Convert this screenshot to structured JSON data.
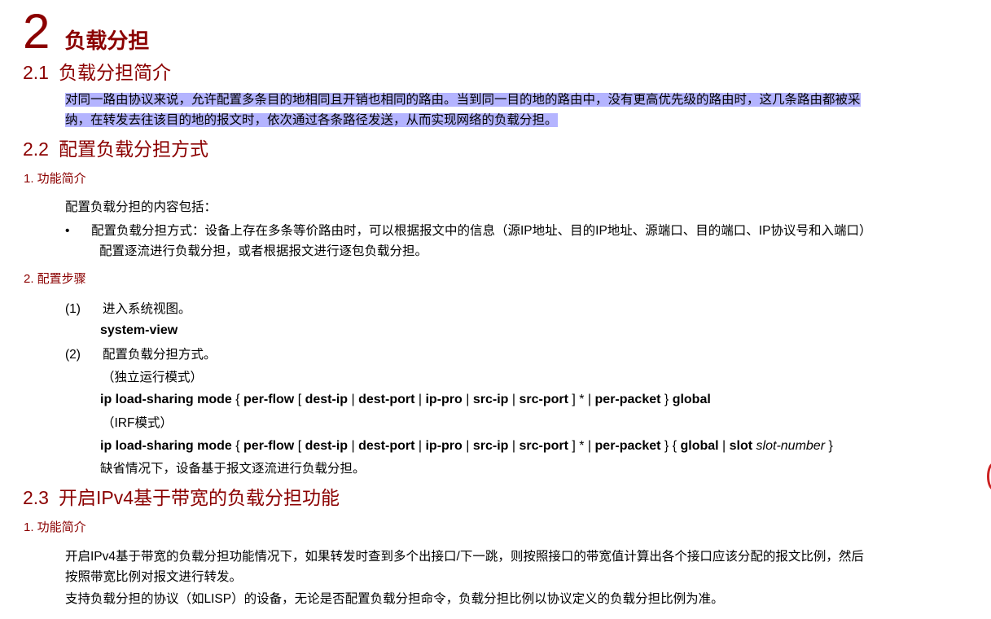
{
  "chapter": {
    "number": "2",
    "title": "负载分担"
  },
  "s21": {
    "number": "2.1",
    "title": "负载分担简介",
    "para_line1": "对同一路由协议来说，允许配置多条目的地相同且开销也相同的路由。当到同一目的地的路由中，没有更高优先级的路由时，这几条路由都被采",
    "para_line2": "纳，在转发去往该目的地的报文时，依次通过各条路径发送，从而实现网络的负载分担。"
  },
  "s22": {
    "number": "2.2",
    "title": "配置负载分担方式",
    "sub1_title": "1. 功能简介",
    "intro": "配置负载分担的内容包括：",
    "bullet_symbol": "•",
    "bullet_line1": "配置负载分担方式：设备上存在多条等价路由时，可以根据报文中的信息（源IP地址、目的IP地址、源端口、目的端口、IP协议号和入端口）",
    "bullet_line2": "配置逐流进行负载分担，或者根据报文进行逐包负载分担。",
    "sub2_title": "2. 配置步骤",
    "step1_num": "(1)",
    "step1_text": "进入系统视图。",
    "step1_cmd": "system-view",
    "step2_num": "(2)",
    "step2_text": "配置负载分担方式。",
    "mode1": "（独立运行模式）",
    "cmd1": {
      "t1": "ip load-sharing mode",
      "t2": " { ",
      "t3": "per-flow",
      "t4": " [ ",
      "t5": "dest-ip",
      "t6": " | ",
      "t7": "dest-port",
      "t8": " | ",
      "t9": "ip-pro",
      "t10": " | ",
      "t11": "src-ip",
      "t12": " | ",
      "t13": "src-port",
      "t14": " ] * | ",
      "t15": "per-packet",
      "t16": " } ",
      "t17": "global"
    },
    "mode2": "（IRF模式）",
    "cmd2": {
      "t1": "ip load-sharing mode",
      "t2": " { ",
      "t3": "per-flow",
      "t4": " [ ",
      "t5": "dest-ip",
      "t6": " | ",
      "t7": "dest-port",
      "t8": " | ",
      "t9": "ip-pro",
      "t10": " | ",
      "t11": "src-ip",
      "t12": " | ",
      "t13": "src-port",
      "t14": " ] * | ",
      "t15": "per-packet",
      "t16": " } { ",
      "t17": "global",
      "t18": " | ",
      "t19": "slot",
      "t20": " ",
      "t21": "slot-number",
      "t22": " }"
    },
    "default_note": "缺省情况下，设备基于报文逐流进行负载分担。"
  },
  "s23": {
    "number": "2.3",
    "title": "开启IPv4基于带宽的负载分担功能",
    "sub1_title": "1. 功能简介",
    "para1_line1": "开启IPv4基于带宽的负载分担功能情况下，如果转发时查到多个出接口/下一跳，则按照接口的带宽值计算出各个接口应该分配的报文比例，然后",
    "para1_line2": "按照带宽比例对报文进行转发。",
    "para2": "支持负载分担的协议（如LISP）的设备，无论是否配置负载分担命令，负载分担比例以协议定义的负载分担比例为准。"
  },
  "colors": {
    "heading": "#8b0000",
    "highlight": "#b4b4ff"
  }
}
